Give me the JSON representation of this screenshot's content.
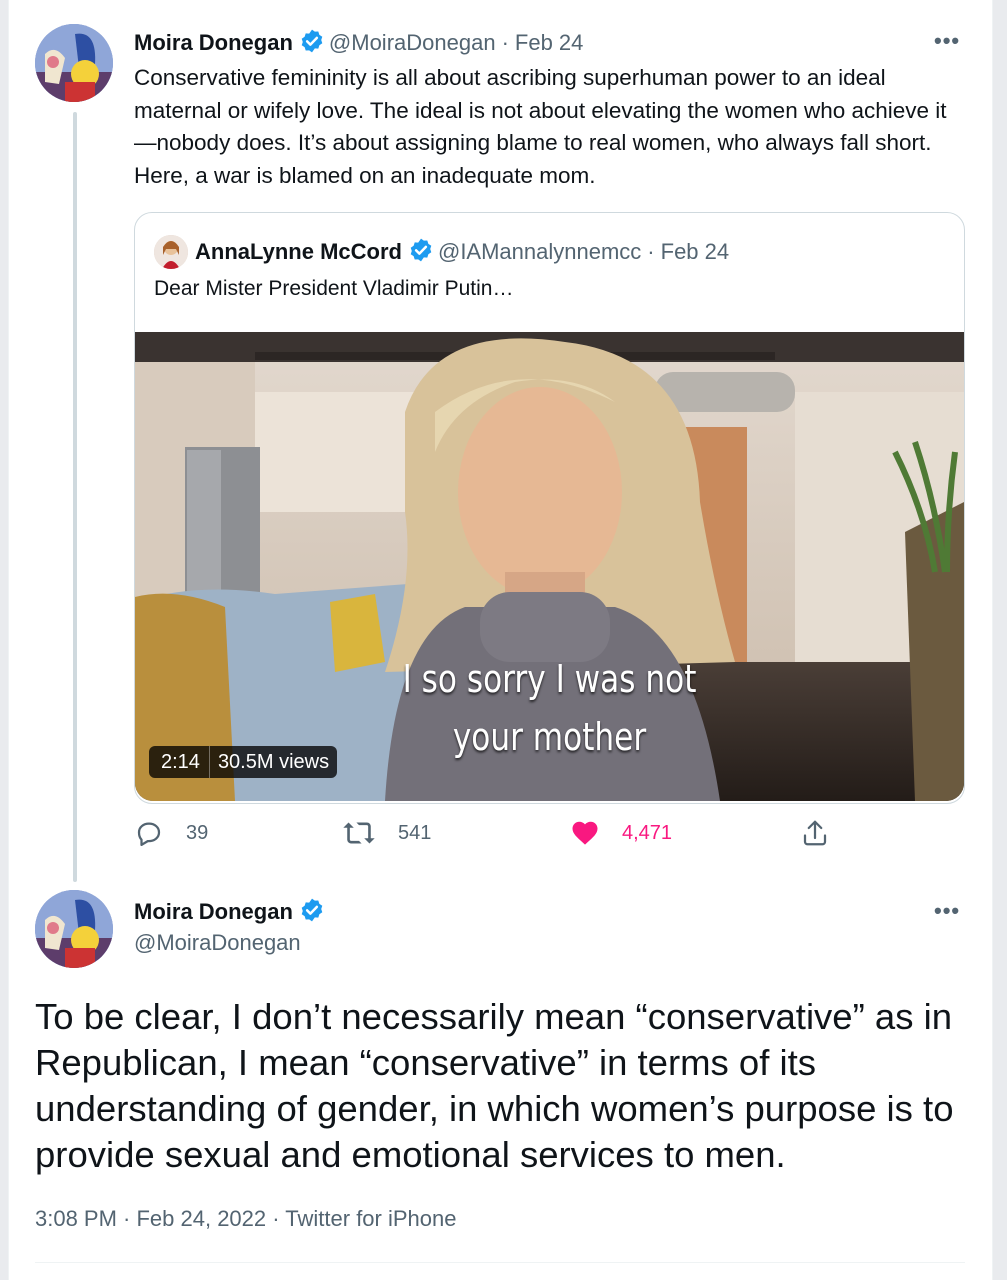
{
  "tweet1": {
    "author_name": "Moira Donegan",
    "handle": "@MoiraDonegan",
    "date": "Feb 24",
    "text": "Conservative femininity is all about ascribing superhuman power to an ideal maternal or wifely love. The ideal is not about elevating the women who achieve it—nobody does. It’s about assigning blame to real women, who always fall short. Here, a war is blamed on an inadequate mom.",
    "quote": {
      "author_name": "AnnaLynne McCord",
      "handle": "@IAMannalynnemcc",
      "date": "Feb 24",
      "text": "Dear Mister President Vladimir Putin…",
      "video": {
        "duration": "2:14",
        "views": "30.5M views",
        "caption_line1": "I so sorry I was not",
        "caption_line2": "your mother"
      }
    },
    "actions": {
      "replies": "39",
      "retweets": "541",
      "likes": "4,471",
      "like_color": "#f91880"
    }
  },
  "tweet2": {
    "author_name": "Moira Donegan",
    "handle": "@MoiraDonegan",
    "text": "To be clear, I don’t necessarily mean “conservative” as in Republican, I mean “conservative” in terms of its understanding of gender, in which women’s purpose is to provide sexual and emotional services to men.",
    "timestamp": "3:08 PM · Feb 24, 2022 · Twitter for iPhone"
  },
  "accent": "#1d9bf0"
}
